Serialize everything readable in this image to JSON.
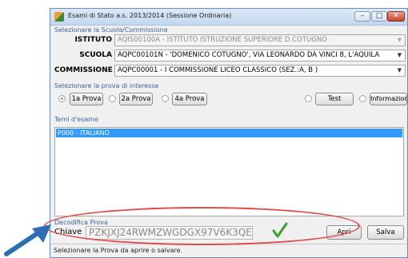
{
  "window": {
    "title": "Esami di Stato a.s. 2013/2014 (Sessione Ordinaria)",
    "controls": {
      "minimize": "–",
      "maximize": "□",
      "close": "✕"
    }
  },
  "school_section": {
    "label": "Selezionare la Scuola/Commissione",
    "istituto": {
      "label": "ISTITUTO",
      "value": "AQIS00100A - ISTITUTO ISTRUZIONE SUPERIORE D.COTUGNO",
      "enabled": false
    },
    "scuola": {
      "label": "SCUOLA",
      "value": "AQPC00101N - 'DOMENICO COTUGNO', VIA LEONARDO DA VINCI 8, L'AQUILA",
      "enabled": true
    },
    "commissione": {
      "label": "COMMISSIONE",
      "value": "AQPC00001 - I COMMISSIONE LICEO CLASSICO (SEZ.:A, B )",
      "enabled": true
    }
  },
  "prova_section": {
    "label": "Selezionare la prova di interesse",
    "options": [
      {
        "label": "1a Prova",
        "selected": true
      },
      {
        "label": "2a Prova",
        "selected": false
      },
      {
        "label": "4a Prova",
        "selected": false
      },
      {
        "label": "Test",
        "selected": false
      },
      {
        "label": "Informazioni",
        "selected": false
      }
    ]
  },
  "temi": {
    "label": "Temi d'esame",
    "items": [
      "P000 - ITALIANO"
    ],
    "selected_index": 0
  },
  "decodifica": {
    "label": "Decodifica Prova",
    "key_label": "Chiave",
    "key_value": "PZKJXJ24RWMZWGDGX97V6K3QE",
    "valid_icon": "checkmark-icon",
    "apri_label": "Apri",
    "salva_label": "Salva"
  },
  "status": {
    "text": "Selezionare la Prova da aprire o salvare."
  },
  "colors": {
    "section_label": "#3a62a6",
    "selection": "#3399ff",
    "annotation_ellipse": "#e04a4a",
    "annotation_arrow": "#2f6db5",
    "check": "#3aa02a"
  }
}
